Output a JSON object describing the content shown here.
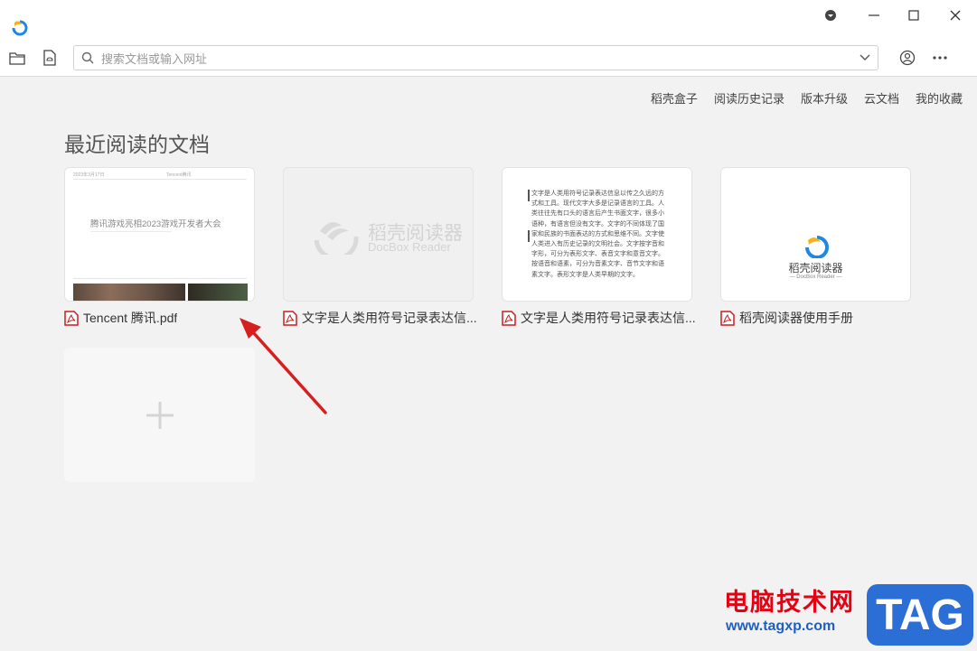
{
  "search": {
    "placeholder": "搜索文档或输入网址",
    "value": ""
  },
  "top_links": [
    "稻壳盒子",
    "阅读历史记录",
    "版本升级",
    "云文档",
    "我的收藏"
  ],
  "section_title": "最近阅读的文档",
  "documents": [
    {
      "name": "Tencent 腾讯.pdf",
      "thumb_title": "腾讯游戏亮相2023游戏开发者大会",
      "thumb_header_left": "2023年3月17日",
      "thumb_header_right": "Tencent腾讯"
    },
    {
      "name": "文字是人类用符号记录表达信...",
      "thumb_brand_cn": "稻壳阅读器",
      "thumb_brand_en": "DocBox Reader"
    },
    {
      "name": "文字是人类用符号记录表达信...",
      "thumb_text": "文字是人类用符号记录表达信息以传之久远的方式和工具。现代文字大多是记录语言的工具。人类往往先有口头的语言后产生书面文字，很多小语种，有语言但没有文字。文字的不同体现了国家和民族的书面表达的方式和思维不同。文字使人类进入有历史记录的文明社会。文字按字音和字形，可分为表形文字、表音文字和意音文字。按语音和语素，可分为音素文字、音节文字和语素文字。表形文字是人类早期的文字。"
    },
    {
      "name": "稻壳阅读器使用手册",
      "thumb_brand_cn": "稻壳阅读器",
      "thumb_brand_en": "— DocBox Reader —"
    }
  ],
  "watermark": {
    "cn": "电脑技术网",
    "url": "www.tagxp.com",
    "tag": "TAG"
  },
  "colors": {
    "pdf_red": "#c81e1e",
    "brand_blue": "#1e88e5",
    "arrow_red": "#d62020"
  }
}
